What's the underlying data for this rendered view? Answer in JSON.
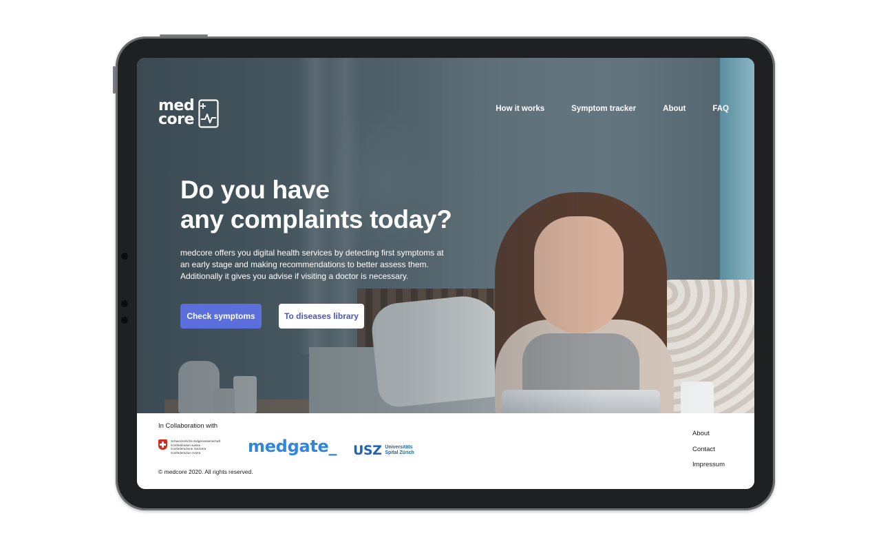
{
  "brand": {
    "logo_line1": "med",
    "logo_line2": "core",
    "logo_icon": "medical-chart-icon"
  },
  "nav": {
    "items": [
      {
        "label": "How it works"
      },
      {
        "label": "Symptom tracker"
      },
      {
        "label": "About"
      },
      {
        "label": "FAQ"
      }
    ]
  },
  "hero": {
    "title_line1": "Do you have",
    "title_line2": "any complaints today?",
    "description": "medcore offers you digital health services by detecting first symptoms at an early stage and making recommendations to better assess them. Additionally it gives you advise if visiting a doctor is necessary.",
    "primary_button": "Check symptoms",
    "secondary_button": "To diseases library"
  },
  "footer": {
    "collab_label": "In Collaboration with",
    "partners": {
      "swiss_lines": [
        "Schweizerische Eidgenossenschaft",
        "Confédération suisse",
        "Confederazione Svizzera",
        "Confederaziun svizra"
      ],
      "medgate": "medgate_",
      "usz_mark": "USZ",
      "usz_line1": "Universitäts",
      "usz_line2": "Spital Zürich"
    },
    "copyright": "© medcore 2020. All rights reserved.",
    "links": [
      {
        "label": "About"
      },
      {
        "label": "Contact"
      },
      {
        "label": "Impressum"
      }
    ]
  },
  "colors": {
    "primary_button": "#5b6fdc",
    "secondary_button_text": "#4756c9",
    "medgate_blue": "#2f86dd",
    "usz_blue": "#1f63b3",
    "tablet_frame": "#1f2021"
  }
}
